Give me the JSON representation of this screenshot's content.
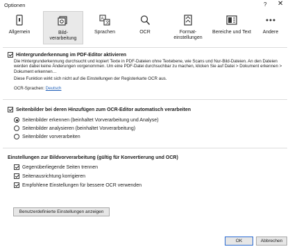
{
  "window": {
    "title": "Optionen",
    "help": "?",
    "close": "✕"
  },
  "tabs": [
    {
      "label": "Allgemein",
      "icon": "phone-icon"
    },
    {
      "label": "Bild-\nverarbeitung",
      "icon": "image-processing-icon",
      "active": true
    },
    {
      "label": "Sprachen",
      "icon": "language-icon"
    },
    {
      "label": "OCR",
      "icon": "magnifier-icon"
    },
    {
      "label": "Format-\neinstellungen",
      "icon": "format-icon"
    },
    {
      "label": "Bereiche und Text",
      "icon": "areas-icon"
    },
    {
      "label": "Andere",
      "icon": "more-icon"
    }
  ],
  "bg_recognition": {
    "label": "Hintergrunderkennung im PDF-Editor aktivieren",
    "checked": true,
    "description": "Die Hintergrunderkennung durchsucht und kopiert Texte in PDF-Dateien ohne Textebene, wie Scans und Nur-Bild-Dateien. An den Dateien werden dabei keine Änderungen vorgenommen. Um eine PDF-Datei durchsuchbar zu machen, klicken Sie auf Datei > Dokument erkennen > Dokument erkennen…",
    "note": "Diese Funktion wirkt sich nicht auf die Einstellungen der Registerkarte OCR aus.",
    "ocr_lang_label": "OCR-Sprachen:",
    "ocr_lang_value": "Deutsch"
  },
  "page_processing": {
    "label": "Seitenbilder bei deren Hinzufügen zum OCR-Editor automatisch verarbeiten",
    "checked": true,
    "options": [
      {
        "label": "Seitenbilder erkennen (beinhaltet Vorverarbeitung und Analyse)",
        "selected": true
      },
      {
        "label": "Seitenbilder analysieren (beinhaltet Vorverarbeitung)",
        "selected": false
      },
      {
        "label": "Seitenbilder vorverarbeiten",
        "selected": false
      }
    ]
  },
  "preprocessing": {
    "heading": "Einstellungen zur Bildvorverarbeitung (gültig für Konvertierung und OCR)",
    "options": [
      {
        "label": "Gegenüberliegende Seiten trennen",
        "checked": true
      },
      {
        "label": "Seitenausrichtung korrigieren",
        "checked": true
      },
      {
        "label": "Empfohlene Einstellungen für bessere OCR verwenden",
        "checked": true
      }
    ],
    "custom_button": "Benutzerdefinierte Einstellungen anzeigen"
  },
  "footer": {
    "ok": "OK",
    "cancel": "Abbrechen"
  }
}
